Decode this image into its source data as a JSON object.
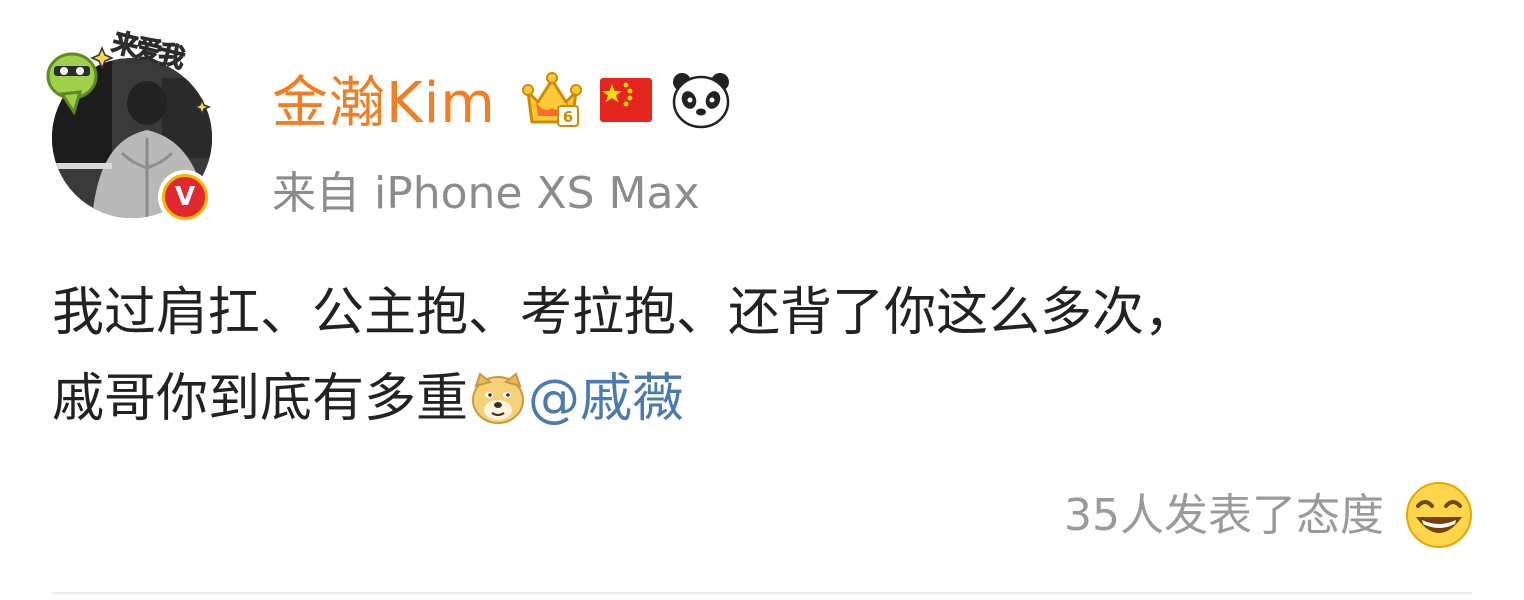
{
  "post": {
    "author": {
      "name": "金瀚Kim",
      "source": "来自 iPhone XS Max",
      "verified_mark": "V",
      "avatar_sticker_text": "来爱我",
      "badges": [
        "crown-level-icon",
        "china-flag-icon",
        "panda-icon"
      ],
      "crown_level": "6"
    },
    "content": {
      "line1": "我过肩扛、公主抱、考拉抱、还背了你这么多次，",
      "line2_text": "戚哥你到底有多重",
      "emoji": "doge-icon",
      "mention": "@戚薇"
    },
    "footer": {
      "reactions_text": "35人发表了态度",
      "reaction_icon": "laughing-face-icon"
    },
    "colors": {
      "username": "#f47d22",
      "mention": "#4a7ab0",
      "meta": "#8c8c8c",
      "text": "#222222"
    }
  }
}
